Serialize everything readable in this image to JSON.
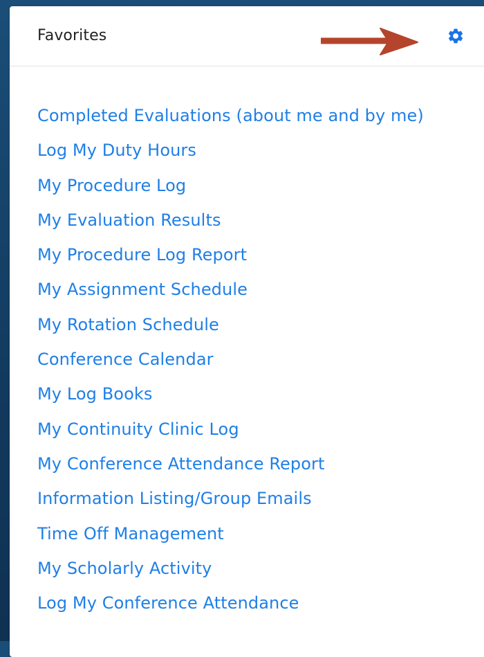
{
  "panel": {
    "title": "Favorites",
    "settings_icon": "gear-icon",
    "annotation_icon": "red-arrow-icon"
  },
  "colors": {
    "link": "#1f7fe6",
    "gear": "#1a73e8",
    "arrow": "#b5442c",
    "background": "#133b5f"
  },
  "links": [
    "Completed Evaluations (about me and by me)",
    "Log My Duty Hours",
    "My Procedure Log",
    "My Evaluation Results",
    "My Procedure Log Report",
    "My Assignment Schedule",
    "My Rotation Schedule",
    "Conference Calendar",
    "My Log Books",
    "My Continuity Clinic Log",
    "My Conference Attendance Report",
    "Information Listing/Group Emails",
    "Time Off Management",
    "My Scholarly Activity",
    "Log My Conference Attendance"
  ]
}
